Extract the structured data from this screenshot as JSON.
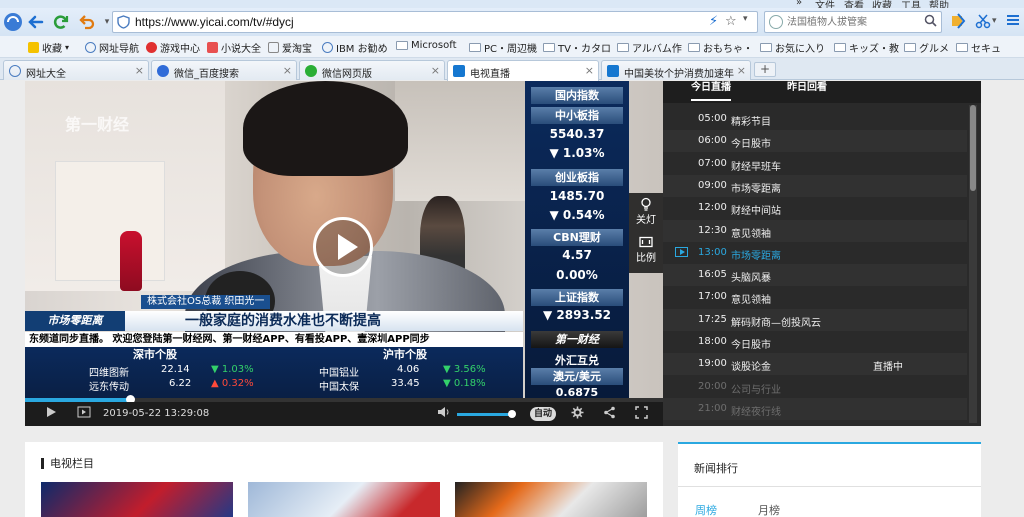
{
  "browser": {
    "menu": [
      "文件",
      "查看",
      "收藏",
      "工具",
      "帮助"
    ],
    "url": "https://www.yicai.com/tv/#dycj",
    "search_placeholder": "法国植物人拔管案",
    "bookmarks": [
      "收藏",
      "网址导航",
      "游戏中心",
      "小说大全",
      "爱淘宝",
      "IBM お勧め",
      "Microsoft",
      "PC・周辺機",
      "TV・カタロ",
      "アルバム作",
      "おもちゃ・",
      "お気に入り",
      "キッズ・教",
      "グルメ",
      "セキュ"
    ],
    "tabs": [
      {
        "label": "网址大全"
      },
      {
        "label": "微信_百度搜索"
      },
      {
        "label": "微信网页版"
      },
      {
        "label": "电视直播"
      },
      {
        "label": "中国美妆个护消费加速年"
      }
    ],
    "new_tab": "+"
  },
  "video": {
    "overlay_text": "第一财经",
    "caption_name": "株式会社OS总裁 织田光一",
    "caption_main": "一般家庭的消费水准也不断提高",
    "show_logo": "市场零距离",
    "ticker": "东频道同步直播。 欢迎您登陆第一财经网、第一财经APP、有看投APP、壹深圳APP同步",
    "stocks": {
      "left_title": "深市个股",
      "right_title": "沪市个股",
      "left": [
        {
          "name": "四维图新",
          "price": "22.14",
          "change": "▼ 1.03%",
          "dir": "up"
        },
        {
          "name": "远东传动",
          "price": "6.22",
          "change": "▲ 0.32%",
          "dir": "down"
        }
      ],
      "right": [
        {
          "name": "中国铝业",
          "price": "4.06",
          "change": "▼ 3.56%",
          "dir": "up"
        },
        {
          "name": "中国太保",
          "price": "33.45",
          "change": "▼ 0.18%",
          "dir": "up"
        }
      ]
    },
    "index_panel": {
      "title": "国内指数",
      "zxb_label": "中小板指",
      "zxb_value": "5540.37",
      "zxb_change": "▼ 1.03%",
      "cyb_label": "创业板指",
      "cyb_value": "1485.70",
      "cyb_change": "▼ 0.54%",
      "cbn_label": "CBN理财",
      "cbn_value": "4.57",
      "cbn_change": "0.00%",
      "sz_label": "上证指数",
      "sz_value": "▼ 2893.52",
      "brand": "第一财经",
      "fx_label": "外汇互兑",
      "fx_pair": "澳元/美元",
      "fx_value": "0.6875"
    },
    "side_controls": {
      "light": "关灯",
      "ratio": "比例"
    },
    "timecode": "2019-05-22 13:29:08",
    "progress": 0.165,
    "volume": 1.0,
    "quality": "自动"
  },
  "schedule": {
    "tabs": [
      "今日直播",
      "昨日回看"
    ],
    "items": [
      {
        "time": "05:00",
        "name": "精彩节目",
        "state": "normal"
      },
      {
        "time": "06:00",
        "name": "今日股市",
        "state": "normal"
      },
      {
        "time": "07:00",
        "name": "财经早班车",
        "state": "normal"
      },
      {
        "time": "09:00",
        "name": "市场零距离",
        "state": "normal"
      },
      {
        "time": "12:00",
        "name": "财经中间站",
        "state": "normal"
      },
      {
        "time": "12:30",
        "name": "意见领袖",
        "state": "normal"
      },
      {
        "time": "13:00",
        "name": "市场零距离",
        "state": "current"
      },
      {
        "time": "16:05",
        "name": "头脑风暴",
        "state": "normal"
      },
      {
        "time": "17:00",
        "name": "意见领袖",
        "state": "normal"
      },
      {
        "time": "17:25",
        "name": "解码财商—创投风云",
        "state": "normal"
      },
      {
        "time": "18:00",
        "name": "今日股市",
        "state": "normal"
      },
      {
        "time": "19:00",
        "name": "谈股论金",
        "state": "normal",
        "badge": "直播中"
      },
      {
        "time": "20:00",
        "name": "公司与行业",
        "state": "past"
      },
      {
        "time": "21:00",
        "name": "财经夜行线",
        "state": "past"
      }
    ]
  },
  "tv_columns": {
    "title": "电视栏目"
  },
  "news_rank": {
    "title": "新闻排行",
    "tabs": [
      "周榜",
      "月榜"
    ]
  },
  "colors": {
    "accent": "#2aa8e0",
    "up": "#33d16a",
    "down": "#ff4a3a"
  }
}
